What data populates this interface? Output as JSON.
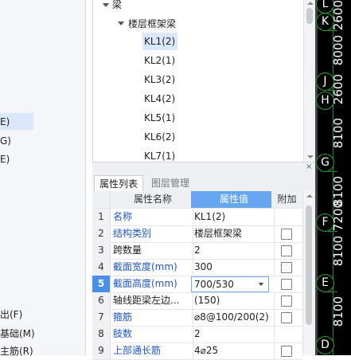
{
  "left_panel": {
    "items": [
      "E)",
      "G)",
      "E)",
      "出(F)",
      "基础(M)",
      "主筋(R)"
    ]
  },
  "tree": {
    "root_label": "梁",
    "group_label": "楼层框架梁",
    "items": [
      "KL1(2)",
      "KL2(1)",
      "KL3(2)",
      "KL4(2)",
      "KL5(1)",
      "KL6(2)",
      "KL7(1)"
    ],
    "selected": "KL1(2)"
  },
  "panel": {
    "close_glyph": "×",
    "tabs": [
      "属性列表",
      "图层管理"
    ],
    "active_tab": "属性列表"
  },
  "grid": {
    "headers": {
      "name": "属性名称",
      "value": "属性值",
      "add": "附加"
    },
    "rows": [
      {
        "no": "1",
        "name": "名称",
        "value": "KL1(2)",
        "blue": true,
        "checkbox": false
      },
      {
        "no": "2",
        "name": "结构类别",
        "value": "楼层框架梁",
        "blue": true,
        "checkbox": true
      },
      {
        "no": "3",
        "name": "跨数量",
        "value": "2",
        "blue": false,
        "checkbox": true
      },
      {
        "no": "4",
        "name": "截面宽度(mm)",
        "value": "300",
        "blue": true,
        "checkbox": true
      },
      {
        "no": "5",
        "name": "截面高度(mm)",
        "value": "700/530",
        "blue": true,
        "checkbox": true,
        "editing": true
      },
      {
        "no": "6",
        "name": "轴线距梁左边...",
        "value": "(150)",
        "blue": false,
        "checkbox": true
      },
      {
        "no": "7",
        "name": "箍筋",
        "value": "⌀8@100/200(2)",
        "blue": true,
        "checkbox": true
      },
      {
        "no": "8",
        "name": "肢数",
        "value": "2",
        "blue": true,
        "checkbox": false
      },
      {
        "no": "9",
        "name": "上部通长筋",
        "value": "4⌀25",
        "blue": true,
        "checkbox": true
      }
    ]
  },
  "cad": {
    "axes": [
      "L",
      "K",
      "J",
      "H",
      "G",
      "F",
      "E",
      "D"
    ],
    "dims": [
      "2600",
      "8000",
      "2600",
      "8100",
      "8100",
      "7200",
      "8100",
      "8100"
    ],
    "colors": {
      "background": "#000000",
      "axis_line": "#25a33a",
      "text": "#ffffff"
    }
  }
}
